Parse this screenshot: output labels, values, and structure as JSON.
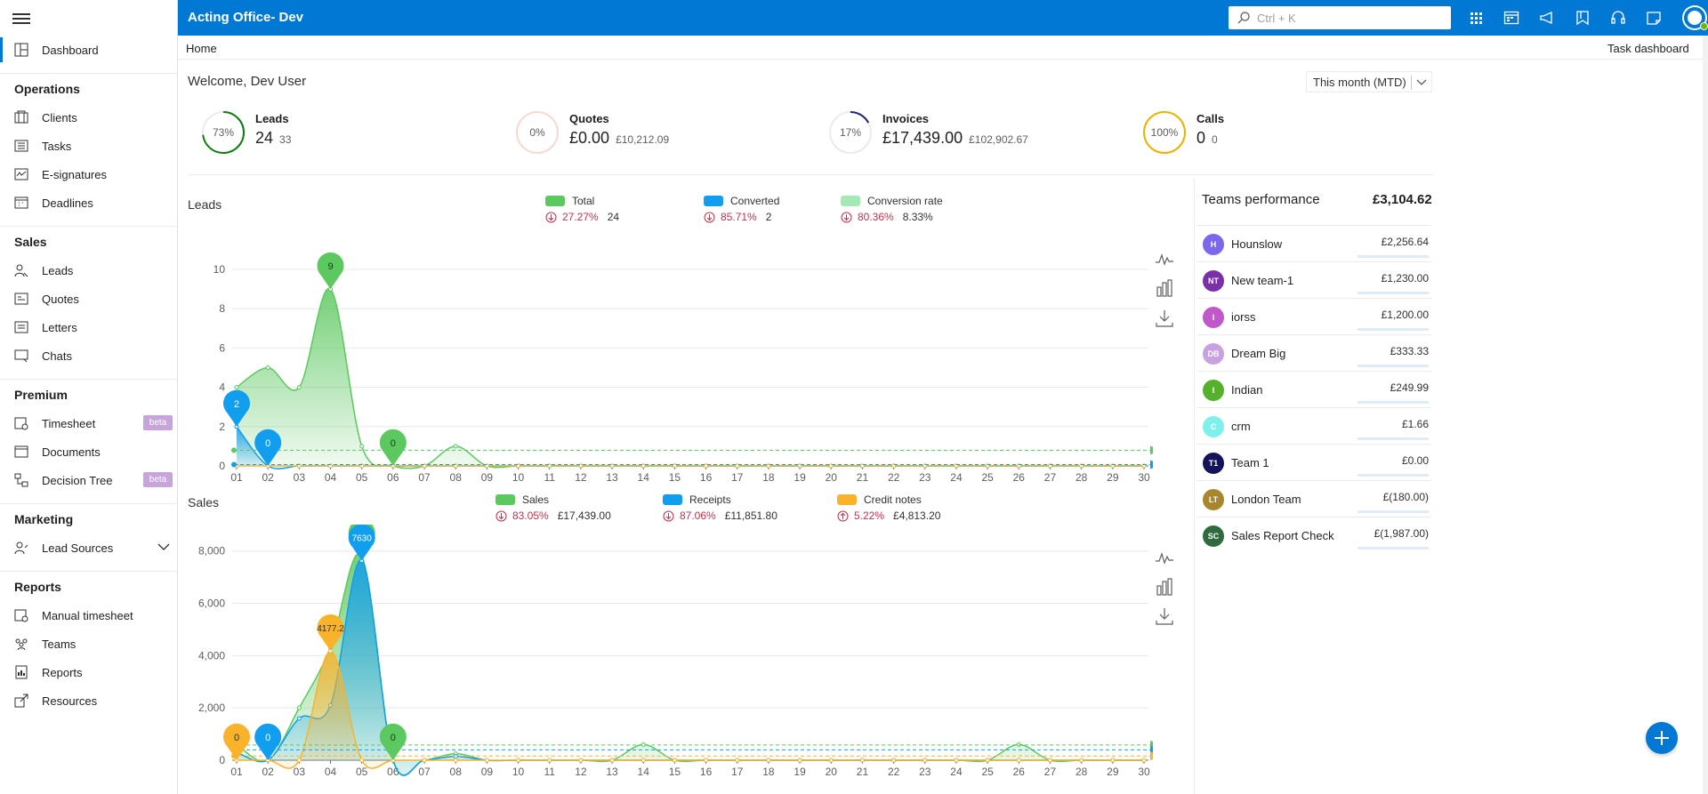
{
  "app": {
    "title": "Acting Office- Dev",
    "search_placeholder": "Ctrl + K"
  },
  "breadcrumb": "Home",
  "task_dashboard": "Task dashboard",
  "sidebar": {
    "dashboard": "Dashboard",
    "operations": {
      "header": "Operations",
      "items": [
        "Clients",
        "Tasks",
        "E-signatures",
        "Deadlines"
      ]
    },
    "sales": {
      "header": "Sales",
      "items": [
        "Leads",
        "Quotes",
        "Letters",
        "Chats"
      ]
    },
    "premium": {
      "header": "Premium",
      "items": [
        "Timesheet",
        "Documents",
        "Decision Tree"
      ],
      "beta": "beta"
    },
    "marketing": {
      "header": "Marketing",
      "items": [
        "Lead Sources"
      ]
    },
    "reports": {
      "header": "Reports",
      "items": [
        "Manual timesheet",
        "Teams",
        "Reports",
        "Resources"
      ]
    }
  },
  "welcome": "Welcome, Dev User",
  "period_select": "This month (MTD)",
  "kpis": [
    {
      "title": "Leads",
      "value": "24",
      "sub": "33",
      "percent_label": "73%",
      "percent": 73,
      "color": "#107c10"
    },
    {
      "title": "Quotes",
      "value": "£0.00",
      "sub": "£10,212.09",
      "percent_label": "0%",
      "percent": 0,
      "color": "#f4c2b8"
    },
    {
      "title": "Invoices",
      "value": "£17,439.00",
      "sub": "£102,902.67",
      "percent_label": "17%",
      "percent": 17,
      "color": "#1a237e"
    },
    {
      "title": "Calls",
      "value": "0",
      "sub": "0",
      "percent_label": "100%",
      "percent": 100,
      "color": "#e8b400"
    }
  ],
  "leads_chart": {
    "title": "Leads",
    "legend": [
      {
        "name": "Total",
        "color": "#5cc860",
        "pct": "27.27%",
        "dir": "down",
        "value": "24"
      },
      {
        "name": "Converted",
        "color": "#119eef",
        "pct": "85.71%",
        "dir": "down",
        "value": "2"
      },
      {
        "name": "Conversion rate",
        "color": "#a4e8b4",
        "pct": "80.36%",
        "dir": "down",
        "value": "8.33%"
      }
    ]
  },
  "sales_chart": {
    "title": "Sales",
    "legend": [
      {
        "name": "Sales",
        "color": "#5cc860",
        "pct": "83.05%",
        "dir": "down",
        "value": "£17,439.00"
      },
      {
        "name": "Receipts",
        "color": "#119eef",
        "pct": "87.06%",
        "dir": "down",
        "value": "£11,851.80"
      },
      {
        "name": "Credit notes",
        "color": "#f8b32b",
        "pct": "5.22%",
        "dir": "up",
        "value": "£4,813.20"
      }
    ]
  },
  "chart_data": [
    {
      "type": "area",
      "title": "Leads",
      "categories": [
        "01",
        "02",
        "03",
        "04",
        "05",
        "06",
        "07",
        "08",
        "09",
        "10",
        "11",
        "12",
        "13",
        "14",
        "15",
        "16",
        "17",
        "18",
        "19",
        "20",
        "21",
        "22",
        "23",
        "24",
        "25",
        "26",
        "27",
        "28",
        "29",
        "30"
      ],
      "ylim": [
        0,
        10
      ],
      "yticks": [
        0,
        2,
        4,
        6,
        8,
        10
      ],
      "series": [
        {
          "name": "Total",
          "color": "#5cc860",
          "values": [
            4,
            5,
            4,
            9,
            1,
            0,
            0,
            1,
            0,
            0,
            0,
            0,
            0,
            0,
            0,
            0,
            0,
            0,
            0,
            0,
            0,
            0,
            0,
            0,
            0,
            0,
            0,
            0,
            0,
            0
          ]
        },
        {
          "name": "Converted",
          "color": "#119eef",
          "values": [
            2,
            0,
            0,
            0,
            0,
            0,
            0,
            0,
            0,
            0,
            0,
            0,
            0,
            0,
            0,
            0,
            0,
            0,
            0,
            0,
            0,
            0,
            0,
            0,
            0,
            0,
            0,
            0,
            0,
            0
          ]
        },
        {
          "name": "Conversion rate",
          "color": "#f8b32b",
          "values": [
            0,
            0,
            0,
            0,
            0,
            0,
            0,
            0,
            0,
            0,
            0,
            0,
            0,
            0,
            0,
            0,
            0,
            0,
            0,
            0,
            0,
            0,
            0,
            0,
            0,
            0,
            0,
            0,
            0,
            0
          ]
        }
      ],
      "pins": [
        {
          "series": "Converted",
          "x_index": 0,
          "label": "2",
          "color": "#119eef"
        },
        {
          "series": "Converted",
          "x_index": 1,
          "label": "0",
          "color": "#119eef"
        },
        {
          "series": "Total",
          "x_index": 3,
          "label": "9",
          "color": "#5cc860"
        },
        {
          "series": "Total",
          "x_index": 5,
          "label": "0",
          "color": "#5cc860"
        }
      ],
      "mark_lines": [
        {
          "value": 0.8,
          "label": "0.8",
          "color": "#5cc860"
        },
        {
          "value": 0.07,
          "label": "0.07",
          "color": "#119eef"
        }
      ]
    },
    {
      "type": "area",
      "title": "Sales",
      "categories": [
        "01",
        "02",
        "03",
        "04",
        "05",
        "06",
        "07",
        "08",
        "09",
        "10",
        "11",
        "12",
        "13",
        "14",
        "15",
        "16",
        "17",
        "18",
        "19",
        "20",
        "21",
        "22",
        "23",
        "24",
        "25",
        "26",
        "27",
        "28",
        "29",
        "30"
      ],
      "ylim": [
        0,
        8500
      ],
      "yticks": [
        0,
        2000,
        4000,
        6000,
        8000
      ],
      "ytick_labels": [
        "0",
        "2,000",
        "4,000",
        "6,000",
        "8,000"
      ],
      "series": [
        {
          "name": "Sales",
          "color": "#5cc860",
          "values": [
            600,
            0,
            2000,
            4300,
            7800,
            0,
            0,
            250,
            0,
            0,
            0,
            0,
            0,
            600,
            0,
            0,
            0,
            0,
            0,
            0,
            0,
            0,
            0,
            0,
            0,
            600,
            0,
            0,
            0,
            0
          ]
        },
        {
          "name": "Receipts",
          "color": "#119eef",
          "values": [
            300,
            0,
            1600,
            2100,
            7630,
            0,
            0,
            150,
            0,
            0,
            0,
            0,
            0,
            0,
            0,
            0,
            0,
            0,
            0,
            0,
            0,
            0,
            0,
            0,
            0,
            0,
            0,
            0,
            0,
            0
          ]
        },
        {
          "name": "Credit notes",
          "color": "#f8b32b",
          "values": [
            0,
            0,
            0,
            4177.2,
            0,
            0,
            0,
            0,
            0,
            0,
            0,
            0,
            0,
            0,
            0,
            0,
            0,
            0,
            0,
            0,
            0,
            0,
            0,
            0,
            0,
            0,
            0,
            0,
            0,
            0
          ]
        }
      ],
      "pins": [
        {
          "series": "Credit notes",
          "x_index": 0,
          "label": "0",
          "color": "#f8b32b"
        },
        {
          "series": "Receipts",
          "x_index": 1,
          "label": "0",
          "color": "#119eef"
        },
        {
          "series": "Credit notes",
          "x_index": 3,
          "label": "4177.2",
          "color": "#f8b32b"
        },
        {
          "series": "Sales",
          "x_index": 4,
          "label": "8010",
          "color": "#5cc860"
        },
        {
          "series": "Receipts",
          "x_index": 4,
          "label": "7630",
          "color": "#119eef"
        },
        {
          "series": "Sales",
          "x_index": 5,
          "label": "0",
          "color": "#5cc860"
        }
      ],
      "mark_lines": [
        {
          "value": 581.3,
          "label": "£581.30",
          "color": "#5cc860"
        },
        {
          "value": 395.06,
          "label": "£395.06",
          "color": "#119eef"
        },
        {
          "value": 160.44,
          "label": "£160.44",
          "color": "#f8b32b"
        }
      ]
    }
  ],
  "teams": {
    "title": "Teams performance",
    "total": "£3,104.62",
    "rows": [
      {
        "initials": "H",
        "name": "Hounslow",
        "value": "£2,256.64",
        "color": "#7b68ee"
      },
      {
        "initials": "NT",
        "name": "New team-1",
        "value": "£1,230.00",
        "color": "#7b2fa8"
      },
      {
        "initials": "I",
        "name": "iorss",
        "value": "£1,200.00",
        "color": "#c158c9"
      },
      {
        "initials": "DB",
        "name": "Dream Big",
        "value": "£333.33",
        "color": "#c8a2e0"
      },
      {
        "initials": "I",
        "name": "Indian",
        "value": "£249.99",
        "color": "#55b02c"
      },
      {
        "initials": "C",
        "name": "crm",
        "value": "£1.66",
        "color": "#7ff0ec"
      },
      {
        "initials": "T1",
        "name": "Team 1",
        "value": "£0.00",
        "color": "#13145a"
      },
      {
        "initials": "LT",
        "name": "London Team",
        "value": "£(180.00)",
        "color": "#a8862c"
      },
      {
        "initials": "SC",
        "name": "Sales Report Check",
        "value": "£(1,987.00)",
        "color": "#2f6b3d"
      }
    ]
  }
}
